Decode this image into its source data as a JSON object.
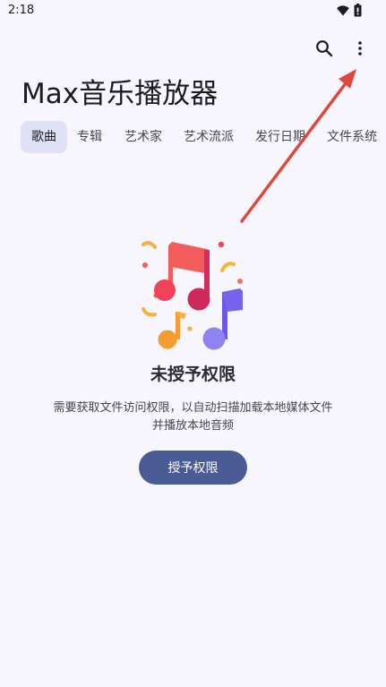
{
  "status_bar": {
    "time": "2:18",
    "icons": [
      "wifi-icon",
      "battery-icon"
    ]
  },
  "app_bar": {
    "title": "Max音乐播放器",
    "actions": [
      "search-icon",
      "more-vert-icon"
    ]
  },
  "tabs": [
    {
      "label": "歌曲",
      "selected": true
    },
    {
      "label": "专辑",
      "selected": false
    },
    {
      "label": "艺术家",
      "selected": false
    },
    {
      "label": "艺术流派",
      "selected": false
    },
    {
      "label": "发行日期",
      "selected": false
    },
    {
      "label": "文件系统",
      "selected": false
    }
  ],
  "empty_state": {
    "illustration": "music-notes-illustration",
    "title": "未授予权限",
    "description": "需要获取文件访问权限，以自动扫描加载本地媒体文件并播放本地音频",
    "button_label": "授予权限"
  },
  "annotation": {
    "arrow_color": "#e0463a",
    "points_to": "more-vert-icon"
  },
  "colors": {
    "background": "#f8f6fd",
    "primary": "#4a5b96",
    "tab_selected_bg": "#dfe1f7",
    "on_surface": "#1c1b1f",
    "on_surface_variant": "#44464f"
  }
}
